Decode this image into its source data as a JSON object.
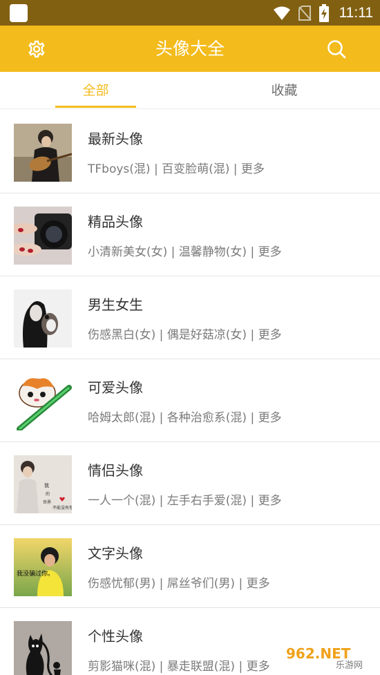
{
  "status_bar": {
    "time": "11:11"
  },
  "app_bar": {
    "title": "头像大全"
  },
  "tabs": {
    "all": "全部",
    "favorites": "收藏"
  },
  "items": [
    {
      "title": "最新头像",
      "subtitle": "TFboys(混) | 百变脸萌(混) | 更多"
    },
    {
      "title": "精品头像",
      "subtitle": "小清新美女(女) | 温馨静物(女) | 更多"
    },
    {
      "title": "男生女生",
      "subtitle": "伤感黑白(女) | 偶是好菇凉(女) | 更多"
    },
    {
      "title": "可爱头像",
      "subtitle": "哈姆太郎(混) | 各种治愈系(混) | 更多"
    },
    {
      "title": "情侣头像",
      "subtitle": "一人一个(混) | 左手右手爱(混) | 更多"
    },
    {
      "title": "文字头像",
      "subtitle": "伤感忧郁(男) | 屌丝爷们(男) | 更多"
    },
    {
      "title": "个性头像",
      "subtitle": "剪影猫咪(混) | 暴走联盟(混) | 更多"
    }
  ],
  "thumb_texts": {
    "couple": "我 的 世界 不能没有你",
    "text_avatar": "我没骗过你。"
  },
  "watermark": {
    "brand": "962.NET",
    "sub": "乐游网"
  },
  "colors": {
    "accent": "#f3bb1b",
    "status_bar": "#826012"
  }
}
